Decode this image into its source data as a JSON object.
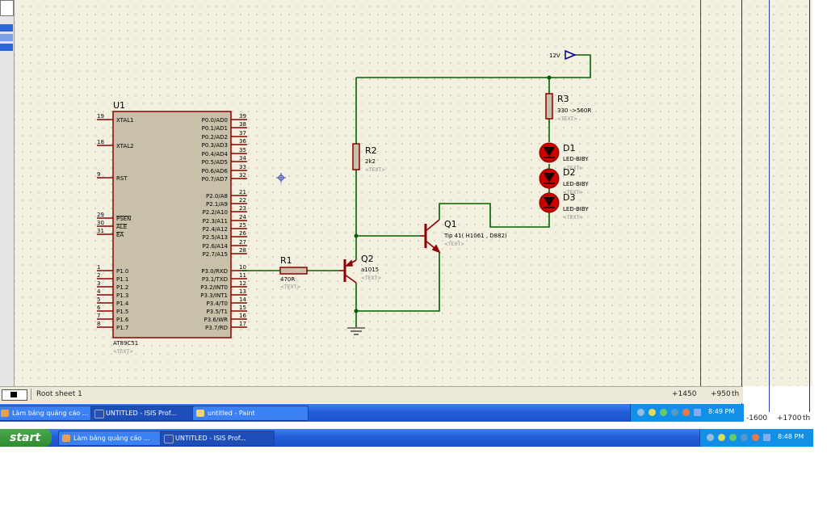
{
  "schematic": {
    "u1": {
      "ref": "U1",
      "part": "AT89C51",
      "text": "<TEXT>",
      "left_pins": [
        {
          "num": "19",
          "name": "XTAL1"
        },
        {
          "num": "18",
          "name": "XTAL2"
        },
        {
          "num": "9",
          "name": "RST"
        },
        {
          "num": "29",
          "name": "PSEN"
        },
        {
          "num": "30",
          "name": "ALE"
        },
        {
          "num": "31",
          "name": "EA"
        },
        {
          "num": "1",
          "name": "P1.0"
        },
        {
          "num": "2",
          "name": "P1.1"
        },
        {
          "num": "3",
          "name": "P1.2"
        },
        {
          "num": "4",
          "name": "P1.3"
        },
        {
          "num": "5",
          "name": "P1.4"
        },
        {
          "num": "6",
          "name": "P1.5"
        },
        {
          "num": "7",
          "name": "P1.6"
        },
        {
          "num": "8",
          "name": "P1.7"
        }
      ],
      "right_pins": [
        {
          "num": "39",
          "name": "P0.0/AD0"
        },
        {
          "num": "38",
          "name": "P0.1/AD1"
        },
        {
          "num": "37",
          "name": "P0.2/AD2"
        },
        {
          "num": "36",
          "name": "P0.3/AD3"
        },
        {
          "num": "35",
          "name": "P0.4/AD4"
        },
        {
          "num": "34",
          "name": "P0.5/AD5"
        },
        {
          "num": "33",
          "name": "P0.6/AD6"
        },
        {
          "num": "32",
          "name": "P0.7/AD7"
        },
        {
          "num": "21",
          "name": "P2.0/A8"
        },
        {
          "num": "22",
          "name": "P2.1/A9"
        },
        {
          "num": "23",
          "name": "P2.2/A10"
        },
        {
          "num": "24",
          "name": "P2.3/A11"
        },
        {
          "num": "25",
          "name": "P2.4/A12"
        },
        {
          "num": "26",
          "name": "P2.5/A13"
        },
        {
          "num": "27",
          "name": "P2.6/A14"
        },
        {
          "num": "28",
          "name": "P2.7/A15"
        },
        {
          "num": "10",
          "name": "P3.0/RXD"
        },
        {
          "num": "11",
          "name": "P3.1/TXD"
        },
        {
          "num": "12",
          "name": "P3.2/INT0"
        },
        {
          "num": "13",
          "name": "P3.3/INT1"
        },
        {
          "num": "14",
          "name": "P3.4/T0"
        },
        {
          "num": "15",
          "name": "P3.5/T1"
        },
        {
          "num": "16",
          "name": "P3.6/WR"
        },
        {
          "num": "17",
          "name": "P3.7/RD"
        }
      ]
    },
    "r1": {
      "ref": "R1",
      "value": "470R",
      "text": "<TEXT>"
    },
    "r2": {
      "ref": "R2",
      "value": "2k2",
      "text": "<TEXT>"
    },
    "r3": {
      "ref": "R3",
      "value": "330 ->560R",
      "text": "<TEXT>"
    },
    "q1": {
      "ref": "Q1",
      "value": "Tip 41( H1061 , D882)",
      "text": "<TEXT>"
    },
    "q2": {
      "ref": "Q2",
      "value": "a1015",
      "text": "<TEXT>"
    },
    "d1": {
      "ref": "D1",
      "value": "LED-BIBY",
      "text": "<TEXT>"
    },
    "d2": {
      "ref": "D2",
      "value": "LED-BIBY",
      "text": "<TEXT>"
    },
    "d3": {
      "ref": "D3",
      "value": "LED-BIBY",
      "text": "<TEXT>"
    },
    "power": {
      "label": "12V"
    }
  },
  "status_bar": {
    "sheet": "Root sheet 1",
    "x_coord": "+1450",
    "y_coord": "+950",
    "unit": "th"
  },
  "outer_coords": {
    "x": "-1600",
    "y": "+1700",
    "unit": "th"
  },
  "taskbar_inner": {
    "items": [
      "Làm bảng quảng cáo ...",
      "UNTITLED - ISIS Prof...",
      "untitled - Paint"
    ],
    "clock": "8:49 PM"
  },
  "taskbar_outer": {
    "start": "start",
    "items": [
      "Làm bảng quảng cáo ...",
      "UNTITLED - ISIS Prof..."
    ],
    "clock": "8:48 PM"
  },
  "colors": {
    "wire": "#006000",
    "component": "#8b0000",
    "body": "#c8c0a8",
    "led": "#cc0000"
  }
}
